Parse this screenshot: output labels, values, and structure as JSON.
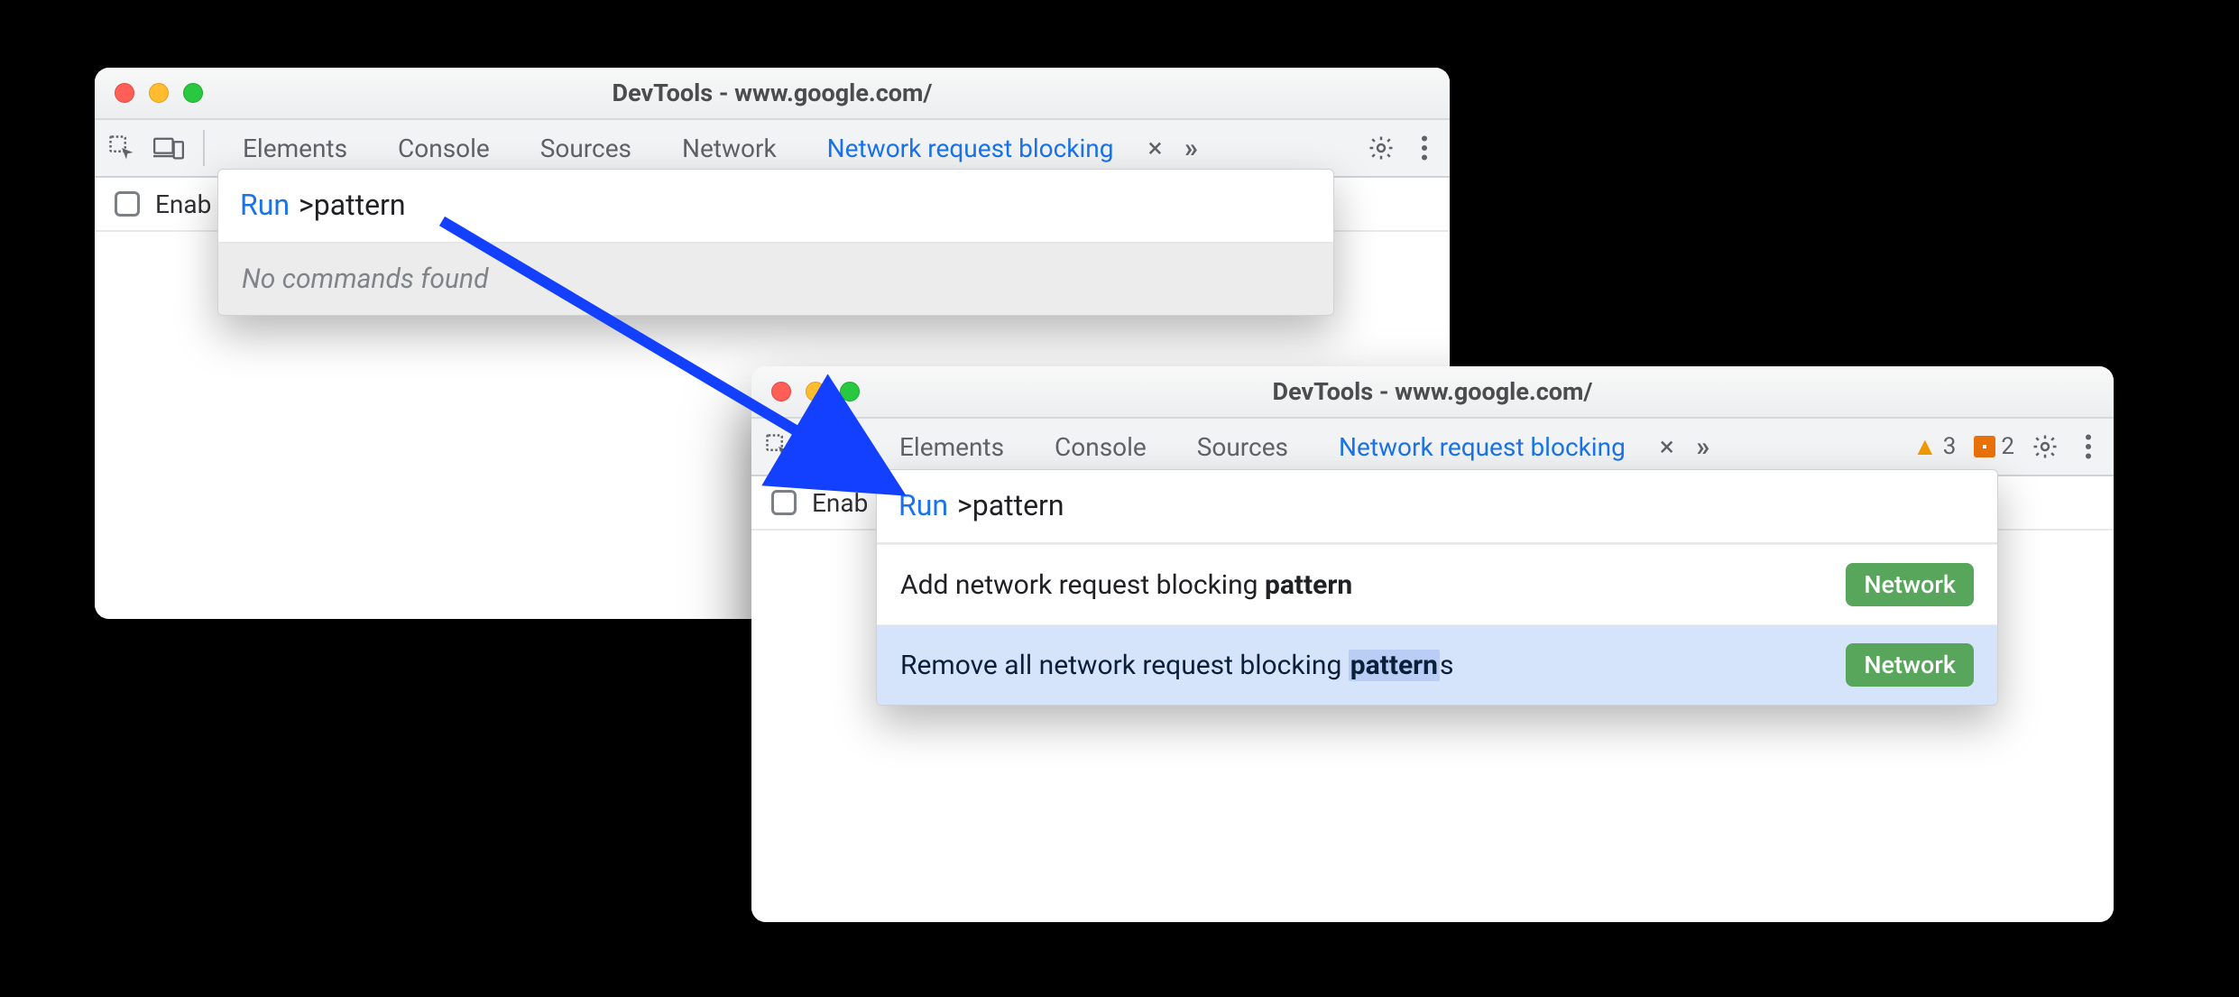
{
  "win1": {
    "title": "DevTools - www.google.com/",
    "tabs": {
      "t1": "Elements",
      "t2": "Console",
      "t3": "Sources",
      "t4": "Network",
      "t5": "Network request blocking"
    },
    "enable_label": "Enab",
    "cmd": {
      "prefix": "Run",
      "query": ">pattern",
      "empty": "No commands found"
    }
  },
  "win2": {
    "title": "DevTools - www.google.com/",
    "tabs": {
      "t1": "Elements",
      "t2": "Console",
      "t3": "Sources",
      "t5": "Network request blocking"
    },
    "enable_label": "Enab",
    "warnings": "3",
    "issues": "2",
    "cmd": {
      "prefix": "Run",
      "query": ">pattern",
      "item1_pre": "Add network request blocking ",
      "item1_b": "pattern",
      "cat": "Network",
      "item2_pre": "Remove all network request blocking ",
      "item2_b": "pattern",
      "item2_suf": "s"
    }
  }
}
